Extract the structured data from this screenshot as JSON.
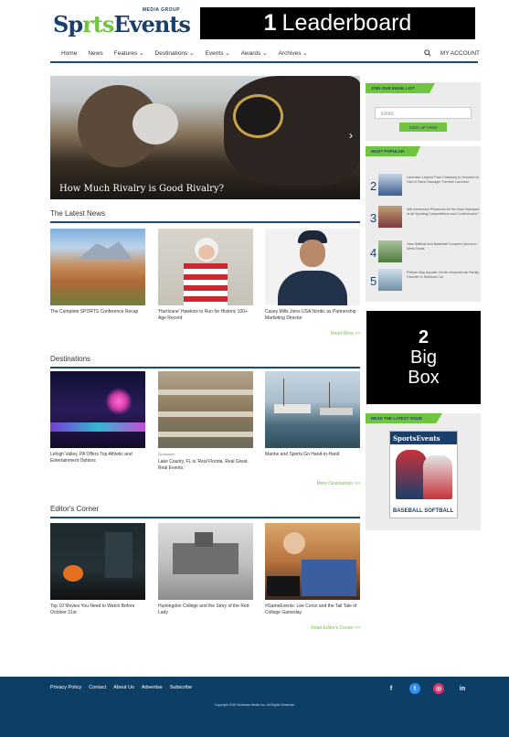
{
  "header": {
    "logo_tag": "MEDIA GROUP",
    "logo_part1": "Sp",
    "logo_part2": "rts",
    "logo_part3": "Events",
    "leaderboard_number": "1",
    "leaderboard_text": "Leaderboard"
  },
  "nav": {
    "items": [
      "Home",
      "News",
      "Features",
      "Destinations",
      "Events",
      "Awards",
      "Archives"
    ],
    "dropdown_marker": "⌄",
    "account": "MY ACCOUNT",
    "search_icon": "search-icon"
  },
  "hero": {
    "caption": "How Much Rivalry is Good Rivalry?"
  },
  "latest_news": {
    "title": "The Latest News",
    "cards": [
      {
        "caption": "The Complete SPORTS Conference Recap"
      },
      {
        "caption": "'Hurricane' Hawkins to Run for Historic 100+ Age Record"
      },
      {
        "caption": "Casey Mills Joins USA Nordic as Partnership Marketing Director"
      }
    ],
    "more": "Read More >>"
  },
  "destinations": {
    "title": "Destinations",
    "cards": [
      {
        "caption": "Lehigh Valley, PA Offers Top Athletic and Entertainment Options"
      },
      {
        "kicker": "Sponsored",
        "caption": "Lake County, FL is 'Real Florida. Real Great. Real Events.'"
      },
      {
        "caption": "Marine and Sports Go Hand-in-Hand"
      }
    ],
    "more": "More Destinations >>"
  },
  "editors_corner": {
    "title": "Editor's Corner",
    "cards": [
      {
        "caption": "Top 10 Movies You Need to Watch Before October 31st"
      },
      {
        "caption": "Huntingdon College and the Story of the Red Lady"
      },
      {
        "caption": "#GameEvents: Lee Corso and the Tail Tale of College Gameday"
      }
    ],
    "more": "Read Editor's Corner >>"
  },
  "sidebar": {
    "email_tag": "JOIN OUR EMAIL LIST",
    "email_placeholder": "EMAIL",
    "signup": "SIGN UP NOW",
    "most_popular_tag": "MOST POPULAR",
    "most_popular": [
      {
        "num": "2",
        "text": "Lacrosse Legend Pam Chastney is Honored at Hall of Fame Manager Tommie Lacrosse"
      },
      {
        "num": "3",
        "text": "Will Immersive Pleasures be the New Standard of all Sporting Competitions and Conferences?"
      },
      {
        "num": "4",
        "text": "New Softball and Baseball Complex Opens in West Texas"
      },
      {
        "num": "5",
        "text": "Pelican Bay Aquatic Center Awarded as Family Favorite in Seafood Cal"
      }
    ],
    "bigbox_number": "2",
    "bigbox_line1": "Big",
    "bigbox_line2": "Box",
    "issue_tag": "READ THE LATEST ISSUE",
    "issue_logo": "SportsEvents",
    "issue_headline": "BASEBALL SOFTBALL"
  },
  "footer": {
    "links": [
      "Privacy Policy",
      "Contact",
      "About Us",
      "Advertise",
      "Subscribe"
    ],
    "copyright": "Copyright 2020 Northstar Media Inc. All Rights Reserved",
    "social": [
      "f",
      "t",
      "◎",
      "in"
    ]
  },
  "colors": {
    "navy": "#1b4a73",
    "green": "#6fc53d",
    "footer": "#0d3f66"
  }
}
